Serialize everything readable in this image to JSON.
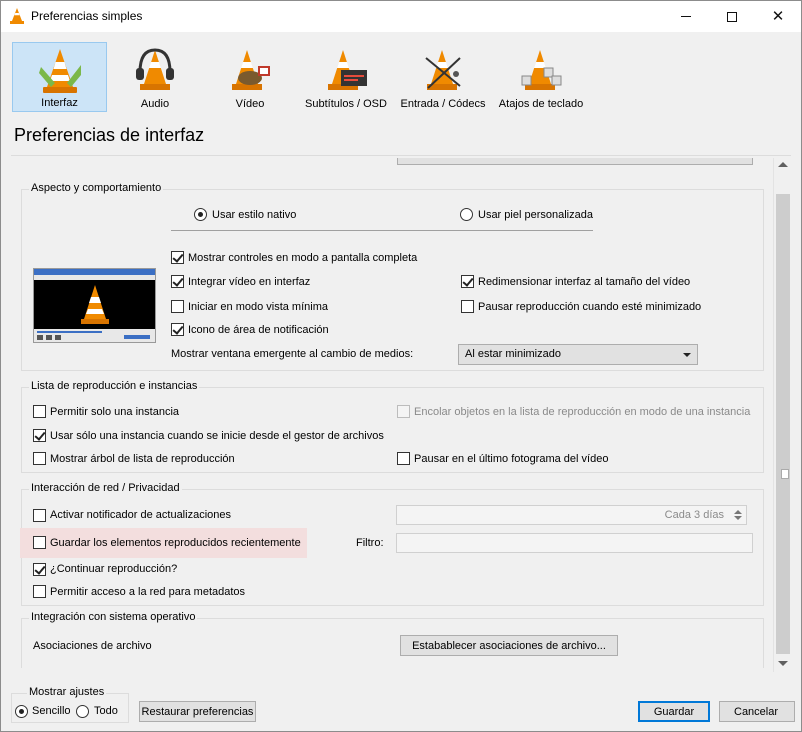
{
  "window": {
    "title": "Preferencias simples"
  },
  "categories": [
    {
      "label": "Interfaz",
      "selected": true
    },
    {
      "label": "Audio",
      "selected": false
    },
    {
      "label": "Vídeo",
      "selected": false
    },
    {
      "label": "Subtítulos / OSD",
      "selected": false
    },
    {
      "label": "Entrada / Códecs",
      "selected": false
    },
    {
      "label": "Atajos de teclado",
      "selected": false
    }
  ],
  "heading": "Preferencias de interfaz",
  "look": {
    "title": "Aspecto y comportamiento",
    "radio_native": {
      "label": "Usar estilo nativo",
      "checked": true
    },
    "radio_skin": {
      "label": "Usar piel personalizada",
      "checked": false
    },
    "fullscreen_controls": {
      "label": "Mostrar controles en modo a pantalla completa",
      "checked": true
    },
    "embed_video": {
      "label": "Integrar vídeo en interfaz",
      "checked": true
    },
    "resize_interface": {
      "label": "Redimensionar interfaz al tamaño del vídeo",
      "checked": true
    },
    "minimal_view": {
      "label": "Iniciar en modo vista mínima",
      "checked": false
    },
    "pause_minimized": {
      "label": "Pausar reproducción cuando esté minimizado",
      "checked": false
    },
    "tray_icon": {
      "label": "Icono de área de notificación",
      "checked": true
    },
    "popup_label": "Mostrar ventana emergente al cambio de medios:",
    "popup_value": "Al estar minimizado"
  },
  "playlist": {
    "title": "Lista de reproducción e instancias",
    "one_instance": {
      "label": "Permitir solo una instancia",
      "checked": false
    },
    "enqueue": {
      "label": "Encolar objetos en la lista de reproducción en modo de una instancia",
      "checked": false
    },
    "one_instance_fm": {
      "label": "Usar sólo una instancia cuando se inicie desde el gestor de archivos",
      "checked": true
    },
    "show_tree": {
      "label": "Mostrar árbol de lista de reproducción",
      "checked": false
    },
    "pause_last_frame": {
      "label": "Pausar en el último fotograma del vídeo",
      "checked": false
    }
  },
  "network": {
    "title": "Interacción de red / Privacidad",
    "update_notifier": {
      "label": "Activar notificador de actualizaciones",
      "checked": false
    },
    "update_interval": "Cada 3 días",
    "save_recent": {
      "label": "Guardar los elementos reproducidos recientemente",
      "checked": false
    },
    "filter_label": "Filtro:",
    "filter_value": "",
    "continue_playback": {
      "label": "¿Continuar reproducción?",
      "checked": true
    },
    "metadata_access": {
      "label": "Permitir acceso a la red para metadatos",
      "checked": false
    }
  },
  "os": {
    "title": "Integración con sistema operativo",
    "assoc_label": "Asociaciones de archivo",
    "assoc_button": "Estabablecer asociaciones de archivo..."
  },
  "footer": {
    "show_settings": "Mostrar ajustes",
    "simple": {
      "label": "Sencillo",
      "checked": true
    },
    "all": {
      "label": "Todo",
      "checked": false
    },
    "reset": "Restaurar preferencias",
    "save": "Guardar",
    "cancel": "Cancelar"
  },
  "icons": [
    "vlc-cone-icon",
    "headphones-icon",
    "film-reel-icon",
    "subtitles-icon",
    "codecs-icon",
    "keyboard-icon",
    "minimize-icon",
    "maximize-icon",
    "close-icon"
  ]
}
